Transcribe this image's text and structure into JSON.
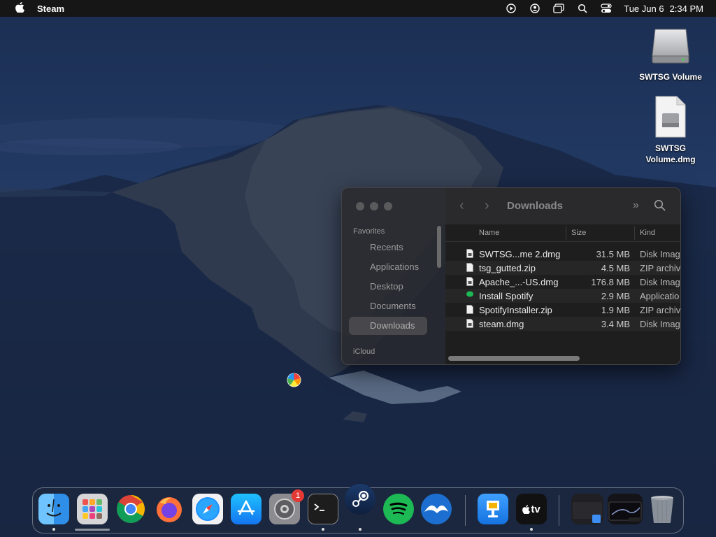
{
  "menubar": {
    "app_name": "Steam",
    "date": "Tue Jun 6",
    "time": "2:34 PM",
    "icons": [
      "play-circle-icon",
      "user-circle-icon",
      "screen-mirroring-icon",
      "search-icon",
      "control-center-icon"
    ]
  },
  "desktop": {
    "icons": [
      {
        "label": "SWTSG Volume",
        "icon": "external-drive-icon"
      },
      {
        "label": "SWTSG Volume.dmg",
        "icon": "dmg-file-icon"
      }
    ]
  },
  "finder": {
    "title": "Downloads",
    "sidebar": {
      "favorites_heading": "Favorites",
      "items": [
        "Recents",
        "Applications",
        "Desktop",
        "Documents",
        "Downloads"
      ],
      "selected": "Downloads",
      "icloud_heading": "iCloud"
    },
    "columns": {
      "name": "Name",
      "size": "Size",
      "kind": "Kind"
    },
    "files": [
      {
        "name": "SWTSG...me 2.dmg",
        "size": "31.5 MB",
        "kind": "Disk Imag",
        "icon": "document-icon"
      },
      {
        "name": "tsg_gutted.zip",
        "size": "4.5 MB",
        "kind": "ZIP archiv",
        "icon": "document-icon"
      },
      {
        "name": "Apache_...-US.dmg",
        "size": "176.8 MB",
        "kind": "Disk Imag",
        "icon": "document-icon"
      },
      {
        "name": "Install Spotify",
        "size": "2.9 MB",
        "kind": "Applicatio",
        "icon": "spotify-icon"
      },
      {
        "name": "SpotifyInstaller.zip",
        "size": "1.9 MB",
        "kind": "ZIP archiv",
        "icon": "document-icon"
      },
      {
        "name": "steam.dmg",
        "size": "3.4 MB",
        "kind": "Disk Imag",
        "icon": "document-icon"
      }
    ]
  },
  "dock": {
    "apps": [
      "Finder",
      "Launchpad",
      "Google Chrome",
      "Firefox",
      "Safari",
      "App Store",
      "System Preferences",
      "Terminal",
      "Steam",
      "Spotify",
      "Mail",
      "Keynote",
      "Apple TV"
    ],
    "system_preferences_badge": "1",
    "tv_label": "tv"
  },
  "colors": {
    "wallpaper": "#172744",
    "finder_sidebar": "#28282c",
    "finder_main": "#1e1e1e",
    "spotify_green": "#1db954",
    "badge_red": "#e53935"
  }
}
